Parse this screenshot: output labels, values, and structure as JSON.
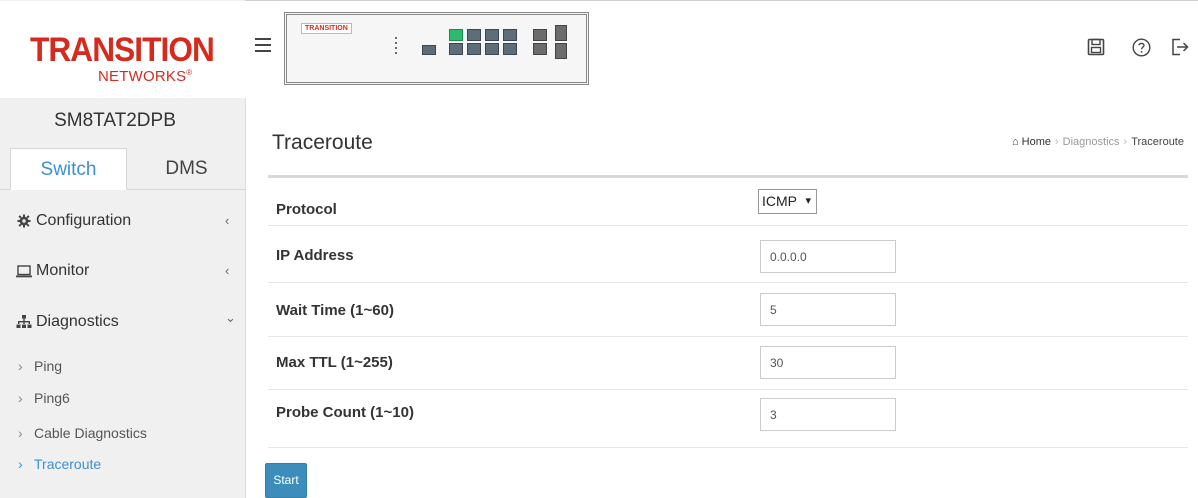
{
  "brand": {
    "logo_top": "TRANSITION",
    "logo_bottom": "NETWORKS",
    "panel_logo": "TRANSITION"
  },
  "device_name": "SM8TAT2DPB",
  "tabs": [
    {
      "label": "Switch",
      "active": true
    },
    {
      "label": "DMS",
      "active": false
    }
  ],
  "menu": [
    {
      "label": "Configuration",
      "icon": "gear-icon",
      "chevron": "‹"
    },
    {
      "label": "Monitor",
      "icon": "monitor-icon",
      "chevron": "‹"
    },
    {
      "label": "Diagnostics",
      "icon": "sitemap-icon",
      "chevron": "⌄"
    }
  ],
  "submenu": [
    {
      "label": "Ping",
      "active": false
    },
    {
      "label": "Ping6",
      "active": false
    },
    {
      "label": "Cable Diagnostics",
      "active": false
    },
    {
      "label": "Traceroute",
      "active": true
    }
  ],
  "header_icons": [
    "save-icon",
    "help-icon",
    "logout-icon"
  ],
  "page": {
    "title": "Traceroute",
    "breadcrumb": {
      "home": "Home",
      "section": "Diagnostics",
      "current": "Traceroute"
    }
  },
  "form": {
    "protocol": {
      "label": "Protocol",
      "value": "ICMP"
    },
    "ip_address": {
      "label": "IP Address",
      "value": "0.0.0.0"
    },
    "wait_time": {
      "label": "Wait Time (1~60)",
      "value": "5"
    },
    "max_ttl": {
      "label": "Max TTL (1~255)",
      "value": "30"
    },
    "probe_count": {
      "label": "Probe Count (1~10)",
      "value": "3"
    }
  },
  "start_button": "Start",
  "colors": {
    "brand_red": "#d52b1e",
    "accent_blue": "#3a8fd5",
    "button_blue": "#3c8dbc"
  }
}
